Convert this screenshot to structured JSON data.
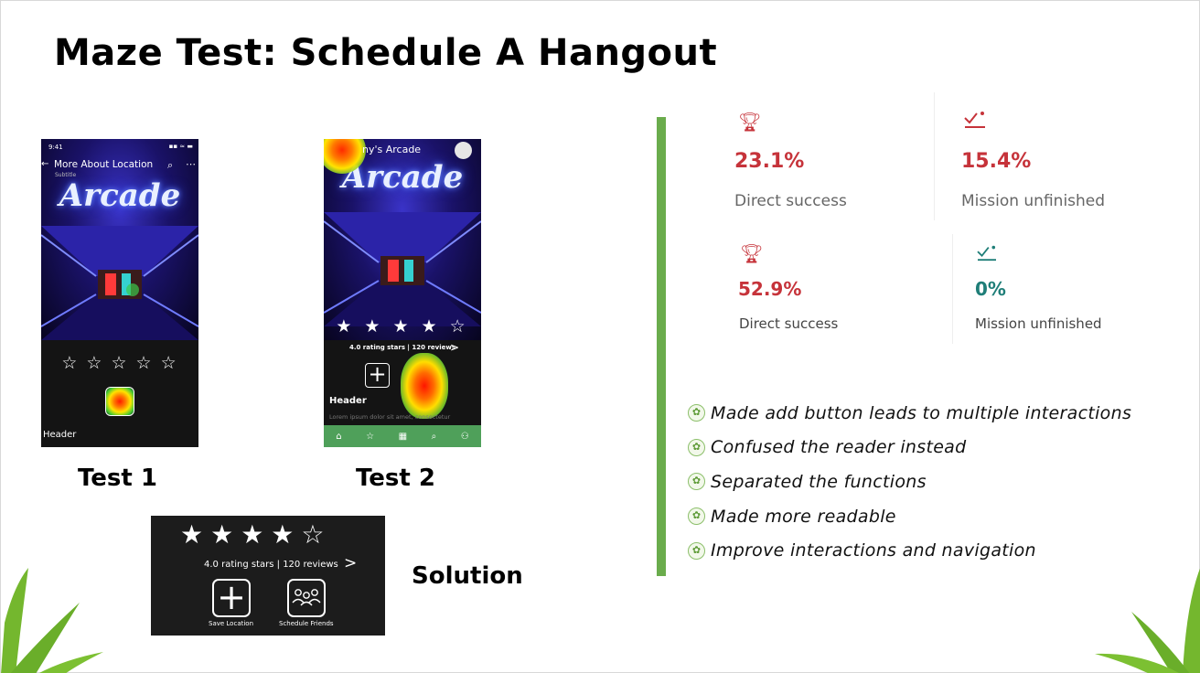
{
  "slide": {
    "title": "Maze Test: Schedule A Hangout"
  },
  "test1": {
    "label": "Test 1",
    "status_time": "9:41",
    "status_icons": "▪▪ ≈ ▬",
    "back_icon": "←",
    "nav_title": "More About Location",
    "nav_subtitle": "Subtitle",
    "sign_text": "Arcade",
    "stars": "☆ ☆ ☆ ☆ ☆",
    "header_label": "Header"
  },
  "test2": {
    "label": "Test 2",
    "phone_title": "ny's Arcade",
    "sign_text": "Arcade",
    "stars": "★ ★ ★ ★ ☆",
    "rating_text": "4.0 rating stars | 120 reviews",
    "chevron": ">",
    "plus": "+",
    "header_label": "Header",
    "lorem": "Lorem ipsum dolor sit amet, consectetur",
    "tab_icons": [
      "⌂",
      "☆",
      "▦",
      "⌕",
      "⚇"
    ]
  },
  "solution": {
    "label": "Solution",
    "stars": "★★★★☆",
    "rating_text": "4.0 rating stars | 120 reviews",
    "chevron": ">",
    "plus": "+",
    "save_caption": "Save Location",
    "schedule_caption": "Schedule Friends"
  },
  "stats": {
    "test1_success_value": "23.1%",
    "test1_success_label": "Direct success",
    "test1_unfinished_value": "15.4%",
    "test1_unfinished_label": "Mission unfinished",
    "test2_success_value": "52.9%",
    "test2_success_label": "Direct success",
    "test2_unfinished_value": "0%",
    "test2_unfinished_label": "Mission unfinished"
  },
  "findings": [
    "Made add button leads to multiple interactions",
    "Confused the reader instead",
    "Separated the functions",
    "Made more readable",
    "Improve interactions and navigation"
  ],
  "colors": {
    "accent_red": "#c6333a",
    "accent_teal": "#1f7e78",
    "green_bar": "#6aac4c",
    "tab_green": "#4fa05a"
  }
}
